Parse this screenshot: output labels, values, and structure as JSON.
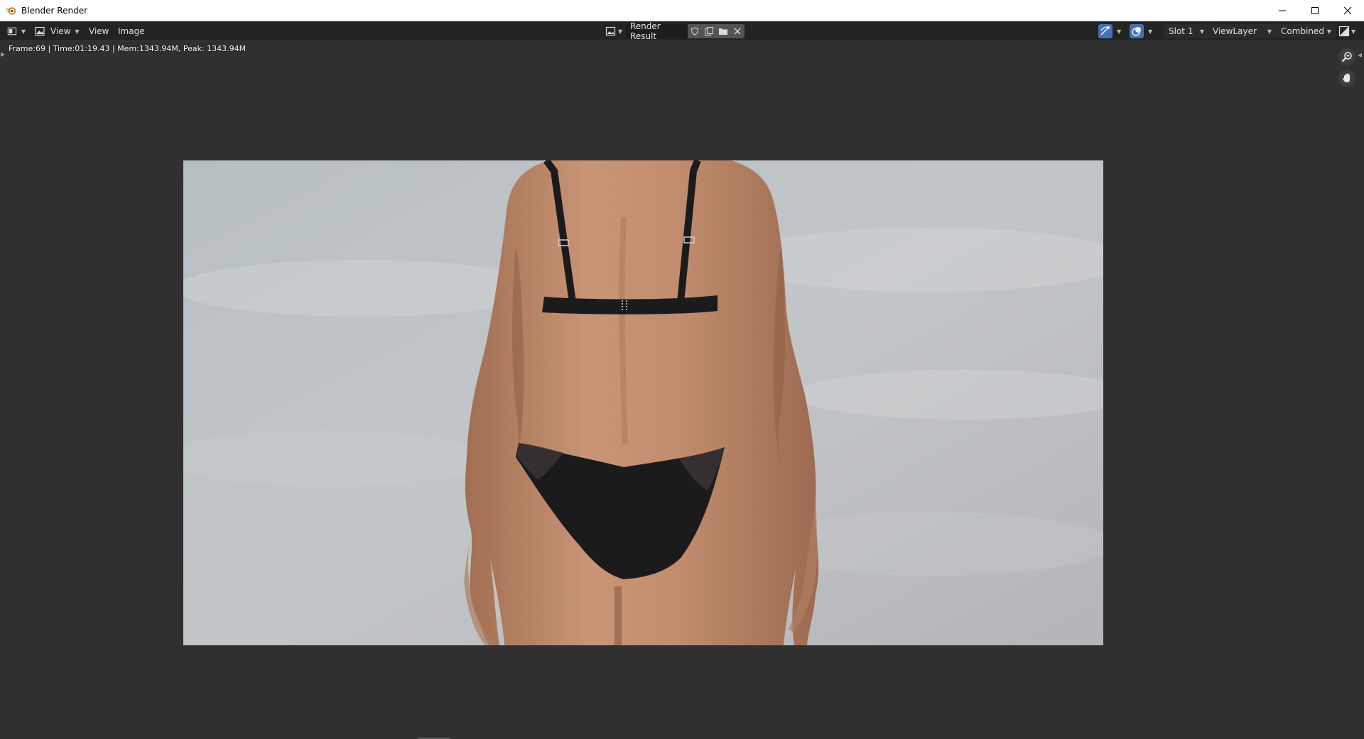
{
  "window": {
    "title": "Blender Render",
    "controls": [
      "minimize",
      "maximize",
      "close"
    ]
  },
  "header": {
    "editor_type_icon": "image-editor-icon",
    "menus": [
      {
        "label": "View"
      },
      {
        "label": "View"
      },
      {
        "label": "Image"
      }
    ],
    "image_name": "Render Result",
    "image_buttons": [
      "fake-user-shield-icon",
      "new-image-icon",
      "open-folder-icon",
      "unlink-x-icon"
    ],
    "slot": "Slot 1",
    "view_layer": "ViewLayer",
    "pass": "Combined",
    "display_channels_icon": "display-channels-icon",
    "gizmo_icons": [
      "gizmo-toggle-icon",
      "overlay-toggle-icon"
    ]
  },
  "viewport": {
    "stats": "Frame:69 | Time:01:19.43 | Mem:1343.94M, Peak: 1343.94M",
    "nav_icons": [
      "zoom-icon",
      "hand-pan-icon"
    ]
  },
  "render": {
    "subject": "rendered photo: back view of a person standing against a cloudy grey sky",
    "sky_color": "#bdc2c5",
    "skin_color": "#c28e70",
    "garment_color": "#1b1b1d"
  },
  "colors": {
    "titlebar_bg": "#ffffff",
    "header_bg": "#232323",
    "viewport_bg": "#303030",
    "accent_blue": "#4772b3"
  }
}
